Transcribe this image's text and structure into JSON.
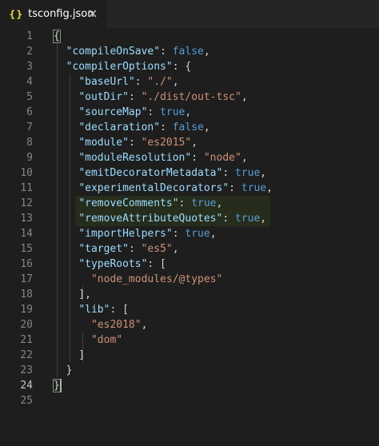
{
  "tab": {
    "icon": "{}",
    "title": "tsconfig.json",
    "close_icon": "close-icon"
  },
  "editor": {
    "active_line": 24,
    "lines": [
      {
        "n": "1",
        "tokens": [
          {
            "t": "p",
            "v": "{"
          }
        ]
      },
      {
        "n": "2",
        "tokens": [
          {
            "t": "p",
            "v": "  "
          },
          {
            "t": "k",
            "v": "\"compileOnSave\""
          },
          {
            "t": "p",
            "v": ": "
          },
          {
            "t": "b",
            "v": "false"
          },
          {
            "t": "p",
            "v": ","
          }
        ]
      },
      {
        "n": "3",
        "tokens": [
          {
            "t": "p",
            "v": "  "
          },
          {
            "t": "k",
            "v": "\"compilerOptions\""
          },
          {
            "t": "p",
            "v": ": {"
          }
        ]
      },
      {
        "n": "4",
        "tokens": [
          {
            "t": "p",
            "v": "    "
          },
          {
            "t": "k",
            "v": "\"baseUrl\""
          },
          {
            "t": "p",
            "v": ": "
          },
          {
            "t": "s",
            "v": "\"./\""
          },
          {
            "t": "p",
            "v": ","
          }
        ]
      },
      {
        "n": "5",
        "tokens": [
          {
            "t": "p",
            "v": "    "
          },
          {
            "t": "k",
            "v": "\"outDir\""
          },
          {
            "t": "p",
            "v": ": "
          },
          {
            "t": "s",
            "v": "\"./dist/out-tsc\""
          },
          {
            "t": "p",
            "v": ","
          }
        ]
      },
      {
        "n": "6",
        "tokens": [
          {
            "t": "p",
            "v": "    "
          },
          {
            "t": "k",
            "v": "\"sourceMap\""
          },
          {
            "t": "p",
            "v": ": "
          },
          {
            "t": "b",
            "v": "true"
          },
          {
            "t": "p",
            "v": ","
          }
        ]
      },
      {
        "n": "7",
        "tokens": [
          {
            "t": "p",
            "v": "    "
          },
          {
            "t": "k",
            "v": "\"declaration\""
          },
          {
            "t": "p",
            "v": ": "
          },
          {
            "t": "b",
            "v": "false"
          },
          {
            "t": "p",
            "v": ","
          }
        ]
      },
      {
        "n": "8",
        "tokens": [
          {
            "t": "p",
            "v": "    "
          },
          {
            "t": "k",
            "v": "\"module\""
          },
          {
            "t": "p",
            "v": ": "
          },
          {
            "t": "s",
            "v": "\"es2015\""
          },
          {
            "t": "p",
            "v": ","
          }
        ]
      },
      {
        "n": "9",
        "tokens": [
          {
            "t": "p",
            "v": "    "
          },
          {
            "t": "k",
            "v": "\"moduleResolution\""
          },
          {
            "t": "p",
            "v": ": "
          },
          {
            "t": "s",
            "v": "\"node\""
          },
          {
            "t": "p",
            "v": ","
          }
        ]
      },
      {
        "n": "10",
        "tokens": [
          {
            "t": "p",
            "v": "    "
          },
          {
            "t": "k",
            "v": "\"emitDecoratorMetadata\""
          },
          {
            "t": "p",
            "v": ": "
          },
          {
            "t": "b",
            "v": "true"
          },
          {
            "t": "p",
            "v": ","
          }
        ]
      },
      {
        "n": "11",
        "tokens": [
          {
            "t": "p",
            "v": "    "
          },
          {
            "t": "k",
            "v": "\"experimentalDecorators\""
          },
          {
            "t": "p",
            "v": ": "
          },
          {
            "t": "b",
            "v": "true"
          },
          {
            "t": "p",
            "v": ","
          }
        ]
      },
      {
        "n": "12",
        "highlight": true,
        "tokens": [
          {
            "t": "p",
            "v": "    "
          },
          {
            "t": "k",
            "v": "\"removeComments\""
          },
          {
            "t": "p",
            "v": ": "
          },
          {
            "t": "b",
            "v": "true"
          },
          {
            "t": "p",
            "v": ","
          }
        ]
      },
      {
        "n": "13",
        "highlight": true,
        "tokens": [
          {
            "t": "p",
            "v": "    "
          },
          {
            "t": "k",
            "v": "\"removeAttributeQuotes\""
          },
          {
            "t": "p",
            "v": ": "
          },
          {
            "t": "b",
            "v": "true"
          },
          {
            "t": "p",
            "v": ","
          }
        ]
      },
      {
        "n": "14",
        "tokens": [
          {
            "t": "p",
            "v": "    "
          },
          {
            "t": "k",
            "v": "\"importHelpers\""
          },
          {
            "t": "p",
            "v": ": "
          },
          {
            "t": "b",
            "v": "true"
          },
          {
            "t": "p",
            "v": ","
          }
        ]
      },
      {
        "n": "15",
        "tokens": [
          {
            "t": "p",
            "v": "    "
          },
          {
            "t": "k",
            "v": "\"target\""
          },
          {
            "t": "p",
            "v": ": "
          },
          {
            "t": "s",
            "v": "\"es5\""
          },
          {
            "t": "p",
            "v": ","
          }
        ]
      },
      {
        "n": "16",
        "tokens": [
          {
            "t": "p",
            "v": "    "
          },
          {
            "t": "k",
            "v": "\"typeRoots\""
          },
          {
            "t": "p",
            "v": ": ["
          }
        ]
      },
      {
        "n": "17",
        "tokens": [
          {
            "t": "p",
            "v": "      "
          },
          {
            "t": "s",
            "v": "\"node_modules/@types\""
          }
        ]
      },
      {
        "n": "18",
        "tokens": [
          {
            "t": "p",
            "v": "    ],"
          }
        ]
      },
      {
        "n": "19",
        "tokens": [
          {
            "t": "p",
            "v": "    "
          },
          {
            "t": "k",
            "v": "\"lib\""
          },
          {
            "t": "p",
            "v": ": ["
          }
        ]
      },
      {
        "n": "20",
        "tokens": [
          {
            "t": "p",
            "v": "      "
          },
          {
            "t": "s",
            "v": "\"es2018\""
          },
          {
            "t": "p",
            "v": ","
          }
        ]
      },
      {
        "n": "21",
        "tokens": [
          {
            "t": "p",
            "v": "      "
          },
          {
            "t": "s",
            "v": "\"dom\""
          }
        ]
      },
      {
        "n": "22",
        "tokens": [
          {
            "t": "p",
            "v": "    ]"
          }
        ]
      },
      {
        "n": "23",
        "tokens": [
          {
            "t": "p",
            "v": "  }"
          }
        ]
      },
      {
        "n": "24",
        "tokens": [
          {
            "t": "p",
            "v": "}"
          }
        ]
      },
      {
        "n": "25",
        "tokens": []
      }
    ]
  },
  "colors": {
    "background": "#1e1e1e",
    "tabbar": "#252526",
    "key": "#9cdcfe",
    "string": "#ce9178",
    "boolean": "#569cd6",
    "punctuation": "#d4d4d4",
    "line_number": "#858585",
    "json_icon": "#cbcb41"
  }
}
